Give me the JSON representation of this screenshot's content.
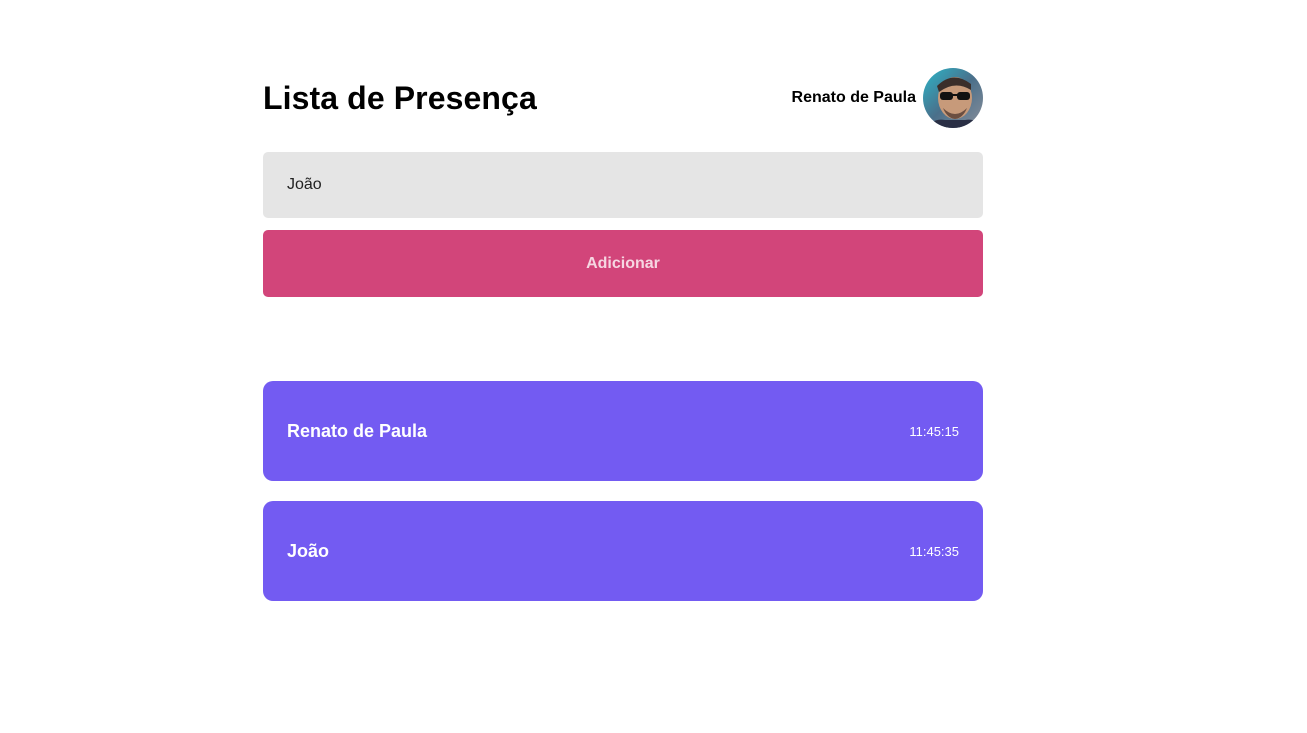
{
  "header": {
    "title": "Lista de Presença",
    "user_name": "Renato de Paula"
  },
  "form": {
    "input_value": "João",
    "button_label": "Adicionar"
  },
  "cards": [
    {
      "name": "Renato de Paula",
      "time": "11:45:15"
    },
    {
      "name": "João",
      "time": "11:45:35"
    }
  ],
  "colors": {
    "accent_button": "#d2457a",
    "button_text": "#f6d7e2",
    "card_background": "#735bf2",
    "input_background": "#e5e5e5"
  }
}
